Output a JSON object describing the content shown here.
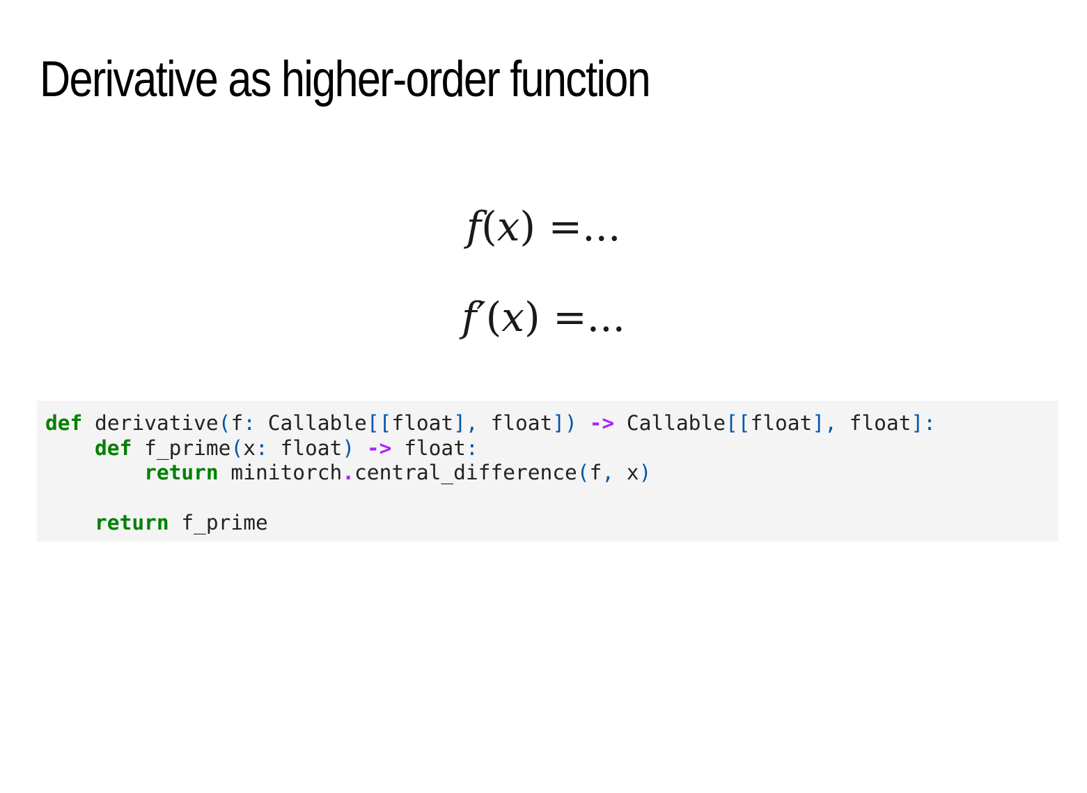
{
  "slide": {
    "title": "Derivative as higher-order function"
  },
  "equations": [
    {
      "lhs_func": "f",
      "lhs_rest": "(x) =...",
      "lhs_var": "x"
    },
    {
      "lhs_func": "f′",
      "lhs_rest": "(x) =...",
      "lhs_var": "x"
    }
  ],
  "code": {
    "language": "python",
    "colors": {
      "background": "#f4f4f4",
      "keyword": "#008000",
      "punctuation": "#0055aa",
      "operator": "#aa22ff",
      "text": "#222222"
    },
    "lines": [
      [
        {
          "t": "def",
          "k": "kw"
        },
        {
          "t": " derivative",
          "k": "t"
        },
        {
          "t": "(",
          "k": "p"
        },
        {
          "t": "f",
          "k": "t"
        },
        {
          "t": ":",
          "k": "p"
        },
        {
          "t": " Callable",
          "k": "t"
        },
        {
          "t": "[[",
          "k": "p"
        },
        {
          "t": "float",
          "k": "t"
        },
        {
          "t": "],",
          "k": "p"
        },
        {
          "t": " float",
          "k": "t"
        },
        {
          "t": "])",
          "k": "p"
        },
        {
          "t": " ",
          "k": "t"
        },
        {
          "t": "->",
          "k": "op"
        },
        {
          "t": " Callable",
          "k": "t"
        },
        {
          "t": "[[",
          "k": "p"
        },
        {
          "t": "float",
          "k": "t"
        },
        {
          "t": "],",
          "k": "p"
        },
        {
          "t": " float",
          "k": "t"
        },
        {
          "t": "]:",
          "k": "p"
        }
      ],
      [
        {
          "t": "    ",
          "k": "t"
        },
        {
          "t": "def",
          "k": "kw"
        },
        {
          "t": " f_prime",
          "k": "t"
        },
        {
          "t": "(",
          "k": "p"
        },
        {
          "t": "x",
          "k": "t"
        },
        {
          "t": ":",
          "k": "p"
        },
        {
          "t": " float",
          "k": "t"
        },
        {
          "t": ")",
          "k": "p"
        },
        {
          "t": " ",
          "k": "t"
        },
        {
          "t": "->",
          "k": "op"
        },
        {
          "t": " float",
          "k": "t"
        },
        {
          "t": ":",
          "k": "p"
        }
      ],
      [
        {
          "t": "        ",
          "k": "t"
        },
        {
          "t": "return",
          "k": "kw"
        },
        {
          "t": " minitorch",
          "k": "t"
        },
        {
          "t": ".",
          "k": "op"
        },
        {
          "t": "central_difference",
          "k": "t"
        },
        {
          "t": "(",
          "k": "p"
        },
        {
          "t": "f",
          "k": "t"
        },
        {
          "t": ",",
          "k": "p"
        },
        {
          "t": " x",
          "k": "t"
        },
        {
          "t": ")",
          "k": "p"
        }
      ],
      [],
      [
        {
          "t": "    ",
          "k": "t"
        },
        {
          "t": "return",
          "k": "kw"
        },
        {
          "t": " f_prime",
          "k": "t"
        }
      ]
    ]
  }
}
